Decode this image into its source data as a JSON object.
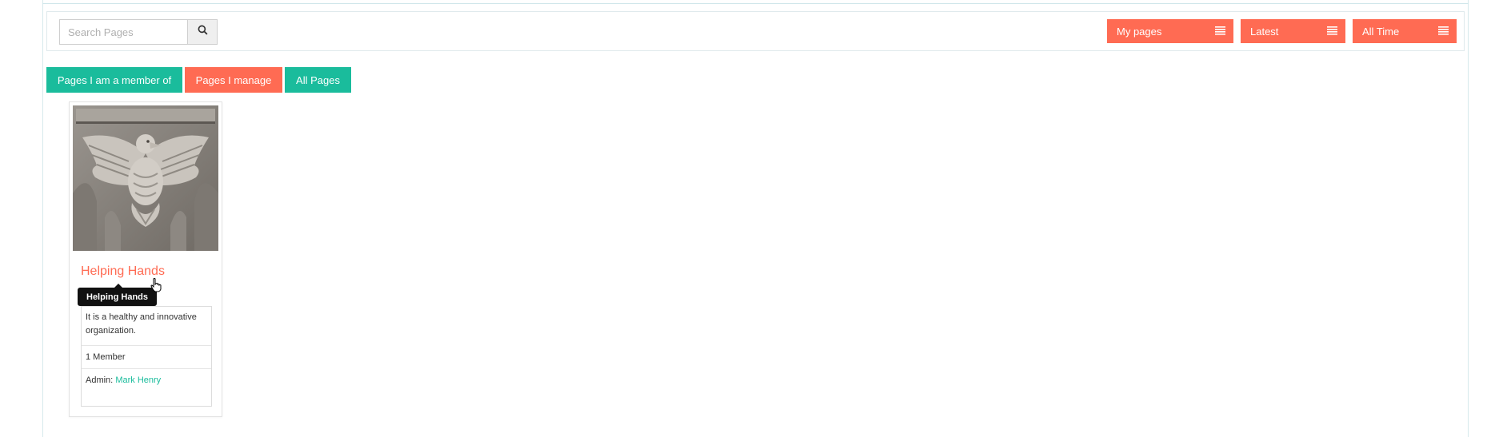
{
  "search": {
    "placeholder": "Search Pages",
    "value": ""
  },
  "filters": {
    "my_pages": "My pages",
    "latest": "Latest",
    "all_time": "All Time"
  },
  "tabs": [
    {
      "label": "Pages I am a member of",
      "color": "#1abc9c"
    },
    {
      "label": "Pages I manage",
      "color": "#ff6b53"
    },
    {
      "label": "All Pages",
      "color": "#1abc9c"
    }
  ],
  "card": {
    "title": "Helping Hands",
    "tooltip": "Helping Hands",
    "description": "It is a healthy and innovative organization.",
    "members": "1 Member",
    "admin_label": "Admin:",
    "admin_name": "Mark Henry"
  },
  "colors": {
    "accent": "#ff6b53",
    "teal": "#1abc9c"
  }
}
